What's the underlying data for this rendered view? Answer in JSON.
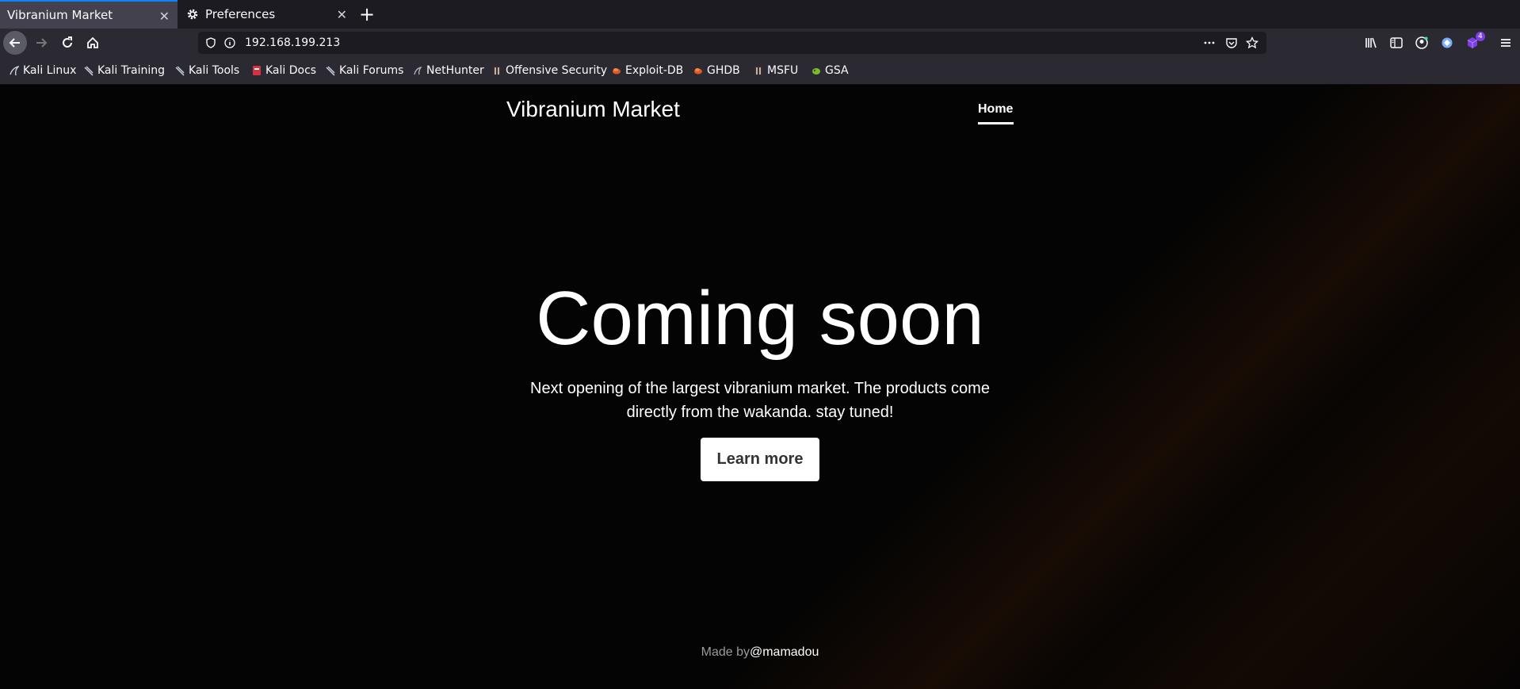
{
  "browser": {
    "tabs": [
      {
        "title": "Vibranium Market",
        "active": true
      },
      {
        "title": "Preferences",
        "active": false
      }
    ],
    "url": "192.168.199.213",
    "bookmarks": [
      {
        "label": "Kali Linux",
        "icon": "kali-dragon-icon"
      },
      {
        "label": "Kali Training",
        "icon": "kali-dragon-icon"
      },
      {
        "label": "Kali Tools",
        "icon": "kali-dragon-icon"
      },
      {
        "label": "Kali Docs",
        "icon": "kali-docs-icon"
      },
      {
        "label": "Kali Forums",
        "icon": "kali-dragon-icon"
      },
      {
        "label": "NetHunter",
        "icon": "nethunter-icon"
      },
      {
        "label": "Offensive Security",
        "icon": "offsec-icon"
      },
      {
        "label": "Exploit-DB",
        "icon": "exploitdb-icon"
      },
      {
        "label": "GHDB",
        "icon": "exploitdb-icon"
      },
      {
        "label": "MSFU",
        "icon": "offsec-icon"
      },
      {
        "label": "GSA",
        "icon": "gsa-icon"
      }
    ],
    "extension_badge": "4"
  },
  "site": {
    "brand": "Vibranium Market",
    "nav_home": "Home",
    "hero_title": "Coming soon",
    "hero_subtitle": "Next opening of the largest vibranium market. The products come directly from the wakanda. stay tuned!",
    "learn_more": "Learn more",
    "footer_prefix": "Made by",
    "footer_author": "@mamadou"
  },
  "colors": {
    "accent": "#0a84ff",
    "page_bg": "#040404"
  }
}
